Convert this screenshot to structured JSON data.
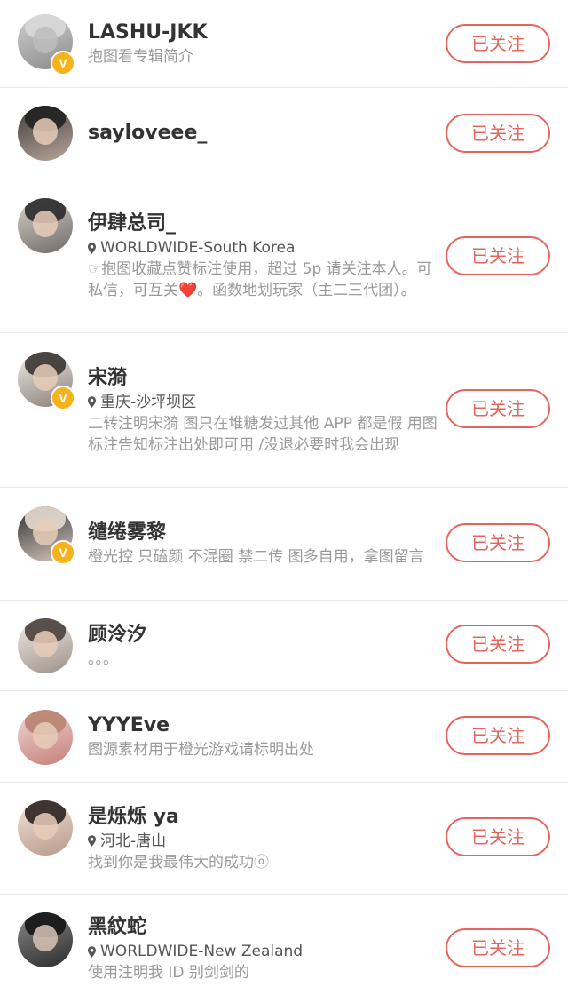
{
  "follow_label": "已关注",
  "colors": {
    "accent": "#e7645e",
    "verified": "#f5b21b"
  },
  "users": [
    {
      "name": "LASHU-JKK",
      "location": "",
      "description": "抱图看专辑简介",
      "verified": true
    },
    {
      "name": "sayloveee_",
      "location": "",
      "description": "",
      "verified": false
    },
    {
      "name": "伊肆总司_",
      "location": "WORLDWIDE-South Korea",
      "description": "☞抱图收藏点赞标注使用，超过 5p 请关注本人。可私信，可互关❤️。函数地划玩家（主二三代团）。",
      "verified": false
    },
    {
      "name": "宋漪",
      "location": "重庆-沙坪坝区",
      "description": "二转注明宋漪 图只在堆糖发过其他 APP 都是假 用图标注告知标注出处即可用 /没退必要时我会出现",
      "verified": true
    },
    {
      "name": "缱绻雾黎",
      "location": "",
      "description": "橙光控 只磕颜 不混圈 禁二传 图多自用，拿图留言",
      "verified": true
    },
    {
      "name": "顾泠汐",
      "location": "",
      "description": "。。。",
      "verified": false
    },
    {
      "name": "YYYEve",
      "location": "",
      "description": "图源素材用于橙光游戏请标明出处",
      "verified": false
    },
    {
      "name": "是烁烁 ya",
      "location": "河北-唐山",
      "description": "找到你是我最伟大的成功ⓞ",
      "verified": false
    },
    {
      "name": "黑紋蛇",
      "location": "WORLDWIDE-New Zealand",
      "description": "使用注明我 ID 别剑剑的",
      "verified": false
    }
  ]
}
